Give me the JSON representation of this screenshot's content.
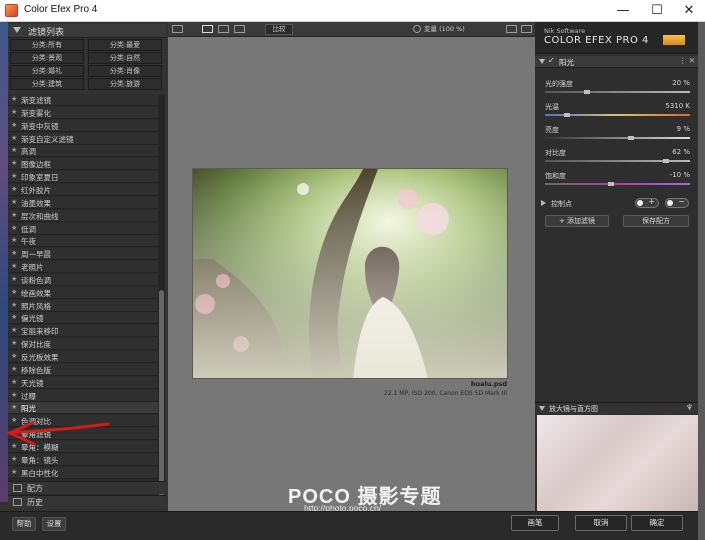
{
  "window": {
    "title": "Color Efex Pro 4",
    "minimize": "—",
    "maximize": "☐",
    "close": "✕"
  },
  "left_panel": {
    "header": "滤镜列表",
    "categories": [
      "分类:所有",
      "分类:最爱",
      "分类:景观",
      "分类:自然",
      "分类:婚礼",
      "分类:肖像",
      "分类:建筑",
      "分类:旅游"
    ],
    "filters": [
      "渐变滤镜",
      "渐变雾化",
      "渐变中灰镜",
      "渐变自定义滤镜",
      "高调",
      "图像边框",
      "印象室夏日",
      "红外胶片",
      "油墨效果",
      "层次和曲线",
      "低调",
      "午夜",
      "周一早晨",
      "老照片",
      "谈粉色调",
      "绘画效果",
      "照片风格",
      "偏光镜",
      "宝丽来移印",
      "保对比度",
      "反光板效果",
      "移除色版",
      "天光镜",
      "过曝",
      "阳光",
      "色调对比",
      "晕角滤镜",
      "晕角：模糊",
      "晕角：镜头",
      "黑白中性化"
    ],
    "active_filter": "阳光",
    "sections": [
      "配方",
      "历史"
    ],
    "bottom_buttons": [
      "帮助",
      "设置"
    ]
  },
  "toolbar": {
    "compare": "比较",
    "zoom": "变量 (100 %)"
  },
  "photo": {
    "filename": "hualu.psd",
    "meta": "22.1 MP, ISO 200, Canon EOS 5D Mark III"
  },
  "watermark": {
    "brand": "POCO 摄影专题",
    "url": "http://photo.poco.cn/"
  },
  "right_panel": {
    "brand_small": "Nik Software",
    "brand_name": "COLOR EFEX PRO 4",
    "filter_name": "阳光",
    "check": "✓",
    "header_controls": "⋮ ✕",
    "sliders": [
      {
        "label": "光的强度",
        "value": "20  %",
        "level": 0.28
      },
      {
        "label": "光温",
        "value": "5310  K",
        "level": 0.14
      },
      {
        "label": "亮度",
        "value": "9  %",
        "level": 0.6
      },
      {
        "label": "对比度",
        "value": "62  %",
        "level": 0.85
      },
      {
        "label": "饱和度",
        "value": "-10  %",
        "level": 0.45
      }
    ],
    "control_points_label": "控制点",
    "add_filter": "+ 添加滤镜",
    "save_recipe": "保存配方",
    "loupe_label": "放大镜与直方图",
    "loupe_pin": "♆"
  },
  "footer": {
    "brush": "画笔",
    "cancel": "取消",
    "ok": "确定"
  },
  "colors": {
    "accent_arrow": "#d21b1b",
    "app_bg": "#2b2b2b",
    "canvas_bg": "#777777"
  }
}
